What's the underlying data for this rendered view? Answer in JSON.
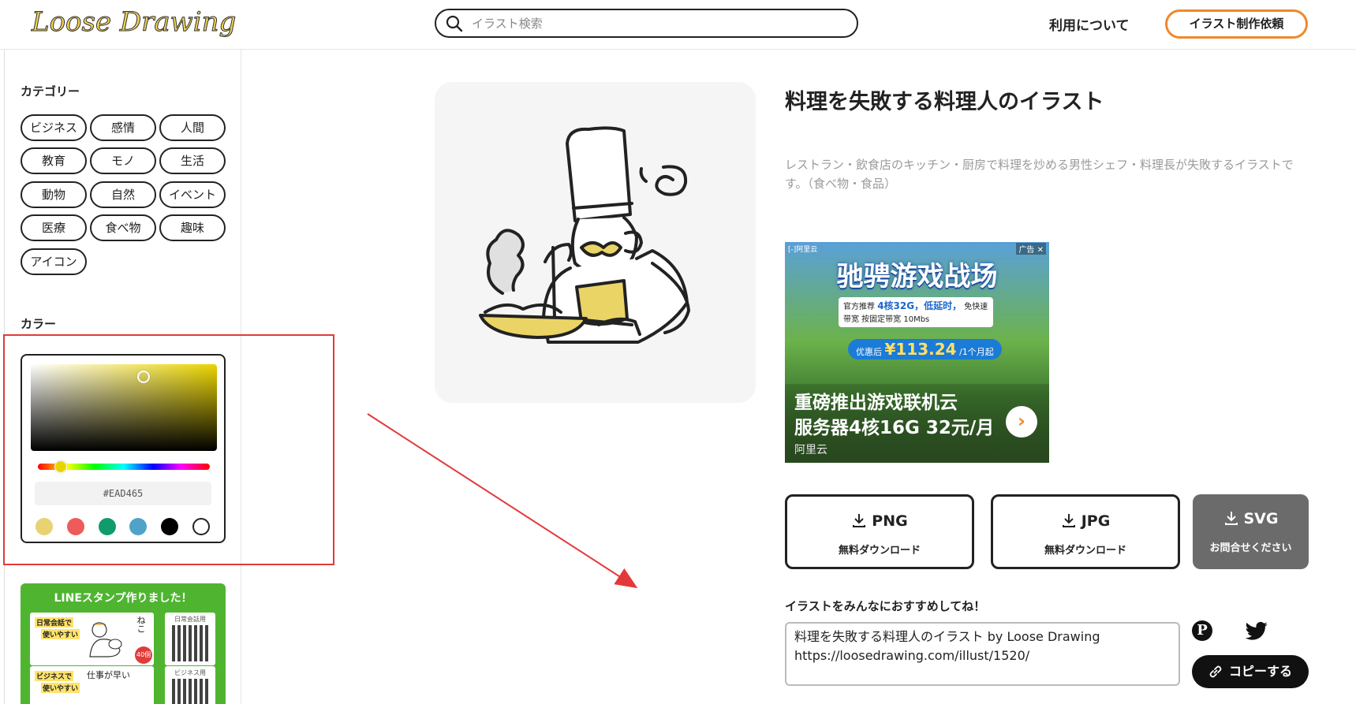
{
  "header": {
    "logo": "Loose Drawing",
    "search_placeholder": "イラスト検索",
    "nav_about": "利用について",
    "nav_order": "イラスト制作依頼"
  },
  "sidebar": {
    "category_heading": "カテゴリー",
    "categories": [
      "ビジネス",
      "感情",
      "人間",
      "教育",
      "モノ",
      "生活",
      "動物",
      "自然",
      "イベント",
      "医療",
      "食べ物",
      "趣味",
      "アイコン"
    ],
    "color_heading": "カラー",
    "color_picker": {
      "hex_value": "#EAD465",
      "swatches": [
        "#e8d272",
        "#ef5a5a",
        "#0f9c6a",
        "#4fa3c7",
        "#000000",
        "#ffffff"
      ]
    },
    "line_banner": {
      "title": "LINEスタンプ作りました！",
      "card1_tag_line1": "日常会話で",
      "card1_tag_line2": "使いやすい",
      "card1_side": "ねこ",
      "card1_badge": "40個",
      "qr1_label": "日常会話用",
      "card2_tag_line1": "ビジネスで",
      "card2_tag_line2": "使いやすい",
      "card2_side": "仕事が早い",
      "qr2_label": "ビジネス用"
    }
  },
  "main": {
    "title": "料理を失敗する料理人のイラスト",
    "description": "レストラン・飲食店のキッチン・厨房で料理を炒める男性シェフ・料理長が失敗するイラストです。（食べ物・食品）",
    "ad": {
      "brand": "[-]阿里云",
      "mark": "广告 ✕",
      "headline": "驰骋游戏战场",
      "info_prefix": "官方推荐",
      "info_highlight": "4核32G，低延时，",
      "info_suffix": "免快速",
      "info_line2": "带宽 按固定带宽 10Mbs",
      "price_prefix": "优惠后",
      "price_value": "¥113.24",
      "price_suffix": "/1个月起",
      "line1": "重磅推出游戏联机云",
      "line2": "服务器4核16G 32元/月",
      "source": "阿里云",
      "go": "›"
    },
    "downloads": [
      {
        "format": "PNG",
        "label": "無料ダウンロード"
      },
      {
        "format": "JPG",
        "label": "無料ダウンロード"
      },
      {
        "format": "SVG",
        "label": "お問合せください"
      }
    ],
    "share": {
      "heading": "イラストをみんなにおすすめしてね！",
      "text_line1": "料理を失敗する料理人のイラスト by Loose Drawing",
      "text_line2": "https://loosedrawing.com/illust/1520/",
      "copy_label": "コピーする"
    }
  },
  "colors": {
    "accent_orange": "#f0882a",
    "annotation_red": "#e23a3a",
    "illustration_yellow": "#ead465"
  }
}
